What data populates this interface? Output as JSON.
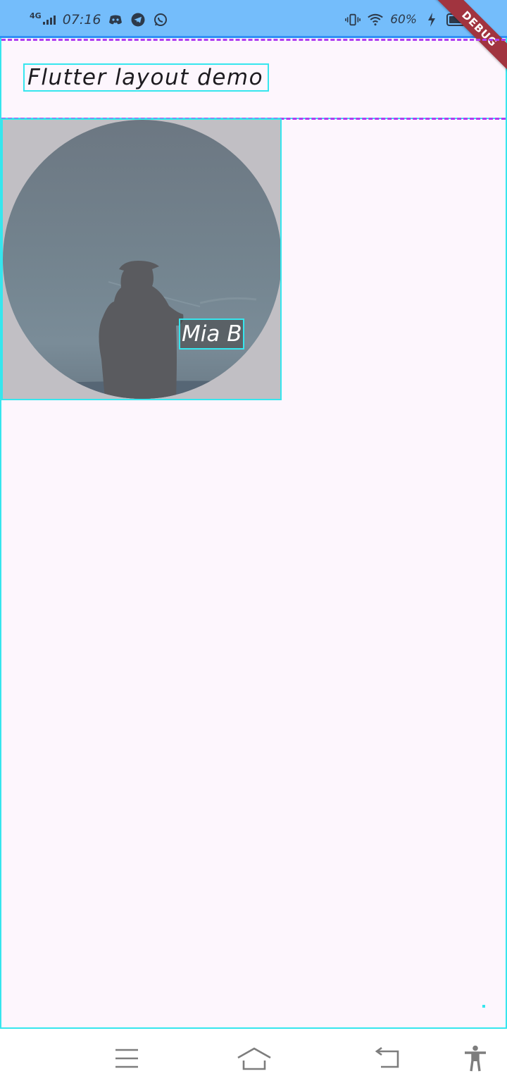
{
  "status_bar": {
    "network": "4G",
    "time": "07:16",
    "battery_percent": "60%",
    "battery_level": 0.6,
    "left_icons": [
      "discord-icon",
      "telegram-icon",
      "whatsapp-icon"
    ],
    "right_icons": [
      "vibrate-icon",
      "wifi-icon",
      "charging-icon",
      "battery-icon"
    ]
  },
  "debug_banner": "DEBUG",
  "app_bar": {
    "title": "Flutter layout demo"
  },
  "avatar": {
    "name": "Mia B"
  },
  "nav_bar": {
    "icons": [
      "menu-icon",
      "home-icon",
      "back-icon",
      "accessibility-icon"
    ]
  },
  "colors": {
    "status_bar": "#74bdfb",
    "background": "#fdf6fd",
    "debug_outline": "#36e6ee",
    "dash_line": "#b03ef0",
    "debug_banner": "#a1343f"
  }
}
